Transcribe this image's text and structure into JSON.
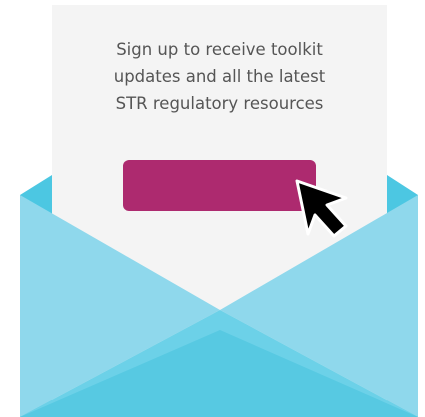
{
  "card": {
    "message_lines": [
      "Sign up to receive toolkit",
      "updates and all the latest",
      "STR regulatory resources"
    ]
  },
  "signup_button": {
    "label": "",
    "color": "#ad2a6f"
  },
  "envelope": {
    "back_color": "#4cc7e2",
    "front_light_color": "#8fd8ec",
    "front_mid_color": "#6cd1e8",
    "bottom_color": "#57c9e2",
    "letter_color": "#f4f4f4"
  },
  "icons": {
    "cursor": "arrow-cursor-icon"
  }
}
